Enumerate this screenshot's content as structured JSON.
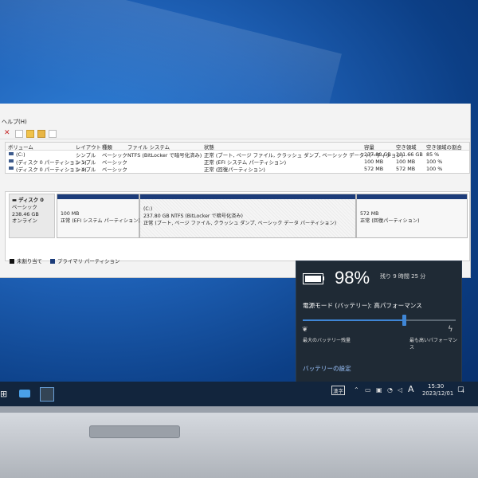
{
  "window": {
    "menubar": "ヘルプ(H)",
    "columns": [
      "ボリューム",
      "レイアウト",
      "種類",
      "ファイル システム",
      "状態",
      "容量",
      "空き領域",
      "空き領域の割合"
    ],
    "volumes": [
      {
        "name": "(C:)",
        "layout": "シンプル",
        "type": "ベーシック",
        "fs": "NTFS (BitLocker で暗号化済み)",
        "status": "正常 (ブート, ページ ファイル, クラッシュ ダンプ, ベーシック データ パーティション)",
        "capacity": "237.80 GB",
        "free": "201.66 GB",
        "pct": "85 %"
      },
      {
        "name": "(ディスク 0 パーティション 1)",
        "layout": "シンプル",
        "type": "ベーシック",
        "fs": "",
        "status": "正常 (EFI システム パーティション)",
        "capacity": "100 MB",
        "free": "100 MB",
        "pct": "100 %"
      },
      {
        "name": "(ディスク 0 パーティション 4)",
        "layout": "シンプル",
        "type": "ベーシック",
        "fs": "",
        "status": "正常 (回復パーティション)",
        "capacity": "572 MB",
        "free": "572 MB",
        "pct": "100 %"
      }
    ],
    "disk": {
      "name": "ディスク 0",
      "type": "ベーシック",
      "size": "238.46 GB",
      "state": "オンライン"
    },
    "partitions": [
      {
        "title": "",
        "line1": "100 MB",
        "line2": "正常 (EFI システム パーティション)"
      },
      {
        "title": "(C:)",
        "line1": "237.80 GB NTFS (BitLocker で暗号化済み)",
        "line2": "正常 (ブート, ページ ファイル, クラッシュ ダンプ, ベーシック データ パーティション)"
      },
      {
        "title": "",
        "line1": "572 MB",
        "line2": "正常 (回復パーティション)"
      }
    ],
    "legend": {
      "unallocated": "未割り当て",
      "primary": "プライマリ パーティション"
    }
  },
  "battery": {
    "percent": "98%",
    "percent_value": 0.98,
    "remaining": "残り 9 時間 25 分",
    "mode_label": "電源モード (バッテリー): 高パフォーマンス",
    "slider_level": 0.66,
    "min_label": "最大のバッテリー残量",
    "max_label": "最も高いパフォーマンス",
    "settings_link": "バッテリーの設定"
  },
  "taskbar": {
    "ime": "漢字",
    "ime_mode": "A",
    "time": "15:30",
    "date": "2023/12/01",
    "notifications": "4"
  },
  "colors": {
    "accent": "#3f86d6",
    "primary_partition": "#1c3c7a",
    "flyout_bg": "#1f2a35"
  }
}
